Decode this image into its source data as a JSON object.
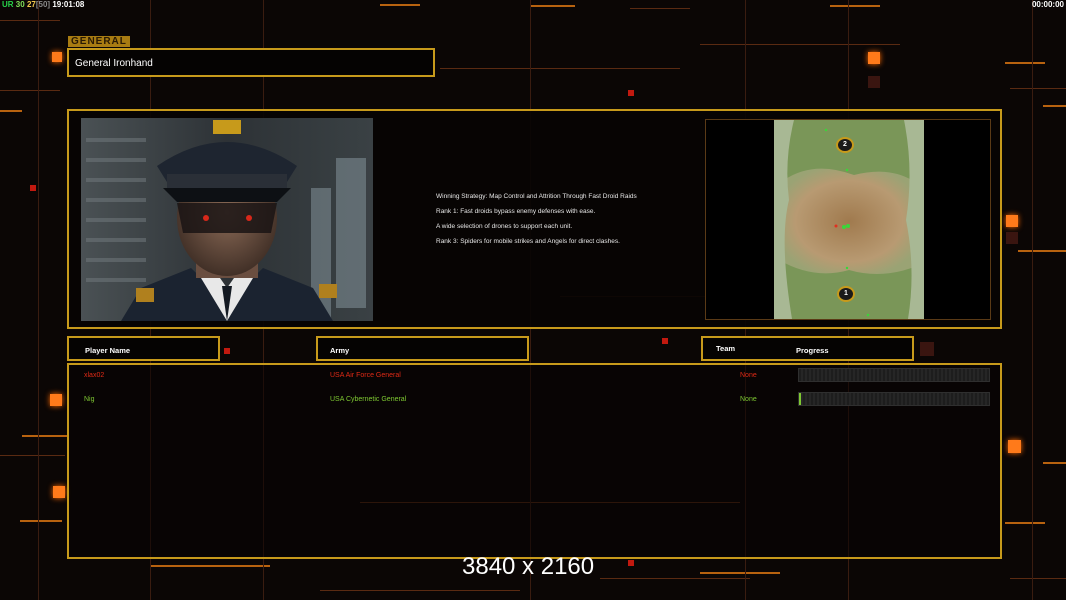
{
  "hud": {
    "ur_label": "UR",
    "stat_a": "30",
    "stat_b": "27",
    "stat_c": "[50]",
    "clock": "19:01:08",
    "timer": "00:00:00"
  },
  "section_tag": "GENERAL",
  "general_name": "General Ironhand",
  "strategy_lines": [
    "Winning Strategy: Map Control and Attrition Through Fast Droid Raids",
    "Rank 1: Fast droids bypass enemy defenses with ease.",
    "A wide selection of drones to support each unit.",
    "Rank 3: Spiders for mobile strikes and Angels for direct clashes."
  ],
  "minimap": {
    "start_positions": [
      "2",
      "1"
    ]
  },
  "table_headers": {
    "player_name": "Player Name",
    "army": "Army",
    "team": "Team",
    "progress": "Progress"
  },
  "players": [
    {
      "name": "xlax02",
      "army": "USA Air Force General",
      "team": "None",
      "color": "#e02a16",
      "progress": 0
    },
    {
      "name": "Nig",
      "army": "USA Cybernetic General",
      "team": "None",
      "color": "#7ec832",
      "progress": 0.01
    }
  ],
  "resolution_label": "3840 x 2160",
  "colors": {
    "frame_gold": "#c79a1b",
    "accent_orange": "#ff7a1a",
    "player_red": "#e02a16",
    "player_green": "#7ec832"
  }
}
